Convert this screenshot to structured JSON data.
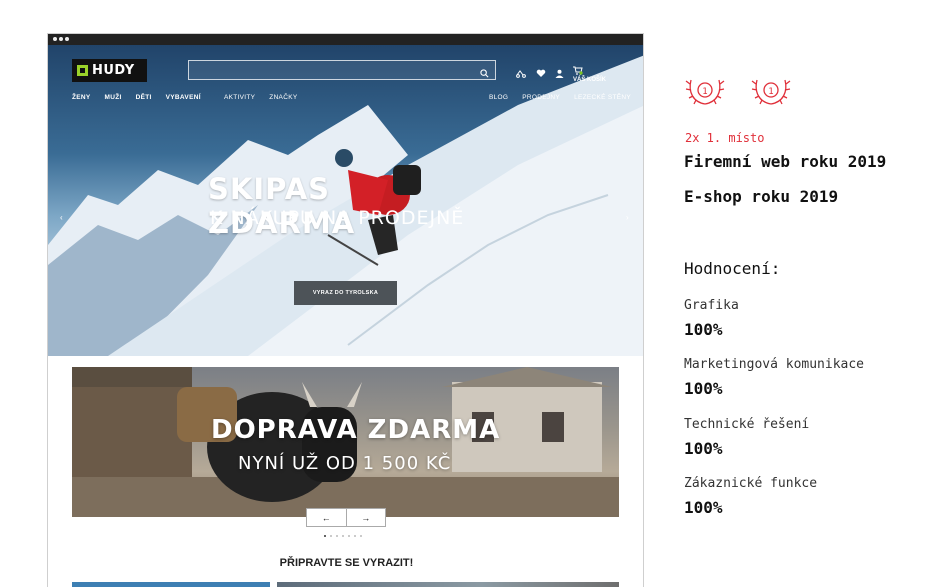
{
  "header": {
    "logo_text": "HUDY",
    "search_placeholder": "",
    "cart_label": "VÁŠ KOŠÍK",
    "nav_left": [
      "ŽENY",
      "MUŽI",
      "DĚTI",
      "VYBAVENÍ"
    ],
    "nav_mid": [
      "AKTIVITY",
      "ZNAČKY"
    ],
    "nav_right": [
      "BLOG",
      "PRODEJNY",
      "LEZECKÉ STĚNY"
    ]
  },
  "hero": {
    "title": "SKIPAS ZDARMA",
    "subtitle": "K NÁKUPU NA PRODEJNĚ",
    "button": "VYRAZ DO TYROLSKA"
  },
  "banner": {
    "title": "DOPRAVA ZDARMA",
    "subtitle": "NYNÍ UŽ OD 1 500 KČ",
    "prev": "←",
    "next": "→"
  },
  "section": {
    "title": "PŘIPRAVTE SE VYRAZIT!"
  },
  "awards": {
    "badge_number": "1",
    "place": "2x 1. místo",
    "lines": [
      "Firemní web roku 2019",
      "E-shop roku 2019"
    ]
  },
  "rating": {
    "heading": "Hodnocení:",
    "items": [
      {
        "label": "Grafika",
        "value": "100%"
      },
      {
        "label": "Marketingová komunikace",
        "value": "100%"
      },
      {
        "label": "Technické řešení",
        "value": "100%"
      },
      {
        "label": "Zákaznické funkce",
        "value": "100%"
      }
    ]
  },
  "colors": {
    "accent_red": "#e0303a",
    "logo_green": "#9bd22a"
  },
  "icons": [
    "search-icon",
    "compare-icon",
    "heart-icon",
    "user-icon",
    "cart-icon",
    "laurel-icon"
  ]
}
